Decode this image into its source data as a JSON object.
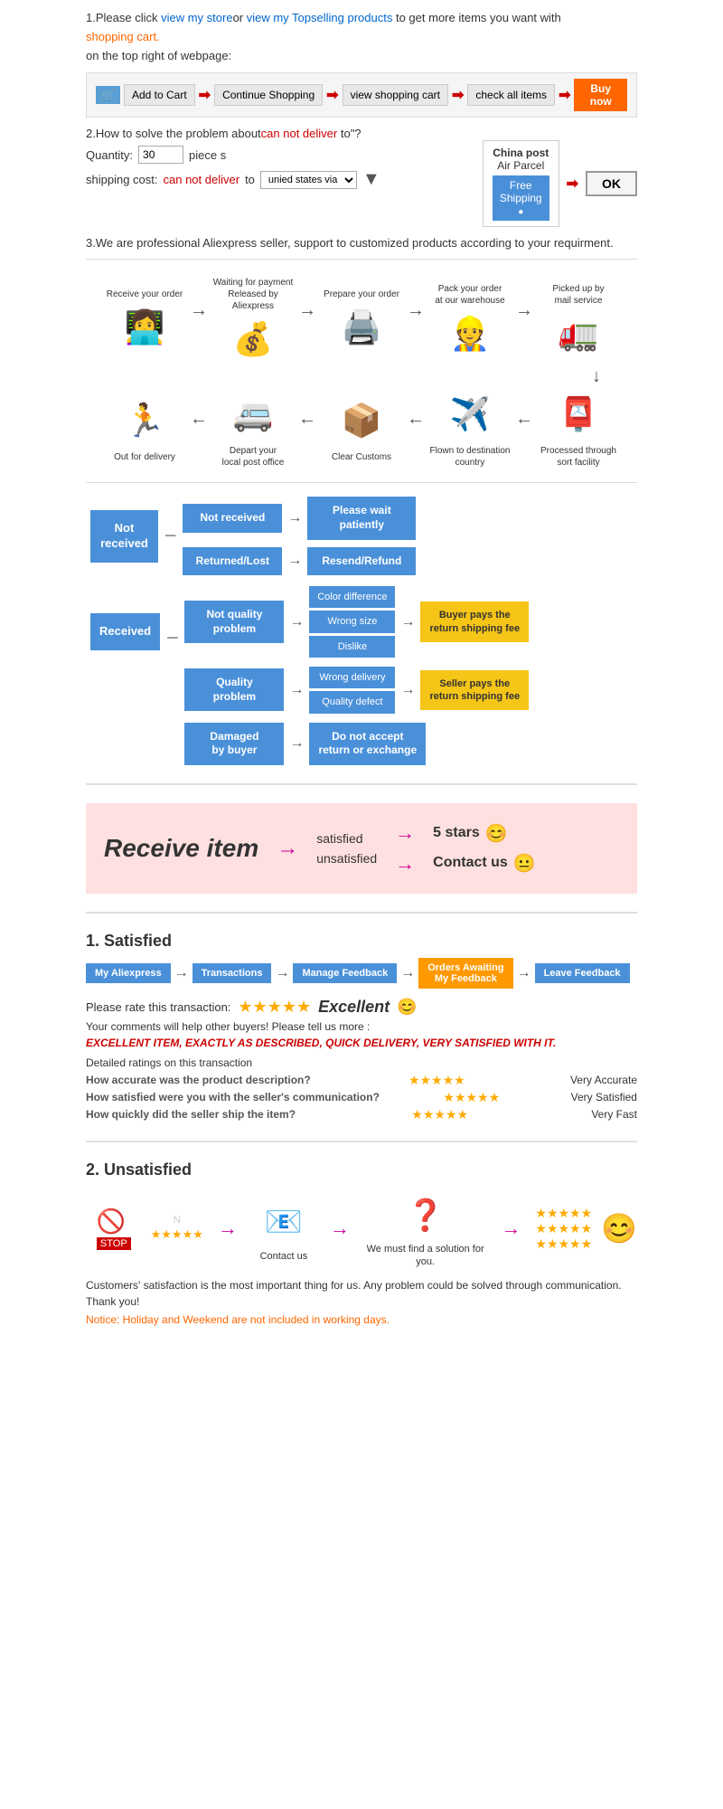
{
  "section1": {
    "text1": "1.Please click ",
    "link1": "view my store",
    "text2": "or ",
    "link2": "view my Topselling products",
    "text3": " to get more items you want with",
    "text4": "shopping cart.",
    "text5": "on the top right of webpage:",
    "cart_icon": "🛒",
    "steps": [
      "Add to Cart",
      "Continue Shopping",
      "view shopping cart",
      "check all items",
      "Buy now"
    ]
  },
  "section2": {
    "title": "2.How to solve the problem about",
    "problem": "can not deliver",
    "title2": " to\"?",
    "qty_label": "Quantity:",
    "qty_value": "30",
    "qty_suffix": "piece s",
    "shipping_label": "shipping cost:",
    "shipping_problem": "can not deliver",
    "shipping_to": " to ",
    "shipping_via": "unied states via",
    "china_post_title": "China post",
    "china_post_sub": "Air Parcel",
    "free_shipping": "Free\nShipping",
    "ok_label": "OK"
  },
  "section3": {
    "text": "3.We are professional Aliexpress seller, support to customized products according to your requirment."
  },
  "process": {
    "row1": [
      {
        "icon": "👩‍💻",
        "label": "Receive your order"
      },
      {
        "icon": "💰",
        "label": "Waiting for payment\nReleased by Aliexpress"
      },
      {
        "icon": "🖨️",
        "label": "Prepare your order"
      },
      {
        "icon": "👷",
        "label": "Pack your order\nat our warehouse"
      },
      {
        "icon": "🚛",
        "label": "Picked up by\nmail service"
      }
    ],
    "row2": [
      {
        "icon": "🏃",
        "label": "Out for delivery"
      },
      {
        "icon": "🚐",
        "label": "Depart your\nlocal post office"
      },
      {
        "icon": "📦",
        "label": "Clear Customs"
      },
      {
        "icon": "✈️",
        "label": "Flown to destination\ncountry"
      },
      {
        "icon": "📮",
        "label": "Processed through\nsort facility"
      }
    ]
  },
  "flowchart": {
    "not_received": "Not received",
    "nr_sub1": "Not received",
    "nr_outcome1": "Please wait\npatiently",
    "nr_sub2": "Returned/Lost",
    "nr_outcome2": "Resend/Refund",
    "received": "Received",
    "rec_sub1": "Not quality\nproblem",
    "rec_sub1_small": [
      "Color difference",
      "Wrong size",
      "Dislike"
    ],
    "rec_sub1_outcome": "Buyer pays the\nreturn shipping fee",
    "rec_sub2": "Quality\nproblem",
    "rec_sub2_small": [
      "Wrong delivery",
      "Quality defect"
    ],
    "rec_sub2_outcome": "Seller pays the\nreturn shipping fee",
    "rec_sub3": "Damaged\nby buyer",
    "rec_sub3_outcome": "Do not accept\nreturn or exchange"
  },
  "receive_item": {
    "title": "Receive item",
    "satisfied": "satisfied",
    "unsatisfied": "unsatisfied",
    "satisfied_result": "5 stars",
    "unsatisfied_result": "Contact us",
    "satisfied_emoji": "😊",
    "unsatisfied_emoji": "😐"
  },
  "satisfied": {
    "title": "1. Satisfied",
    "nav": [
      "My Aliexpress",
      "Transactions",
      "Manage Feedback",
      "Orders Awaiting\nMy Feedback",
      "Leave Feedback"
    ],
    "rate_label": "Please rate this transaction:",
    "excellent": "Excellent",
    "excellent_emoji": "😊",
    "comments_label": "Your comments will help other buyers! Please tell us more :",
    "excellent_text": "EXCELLENT ITEM, EXACTLY AS DESCRIBED, QUICK DELIVERY, VERY SATISFIED WITH IT.",
    "detailed_label": "Detailed ratings on this transaction",
    "ratings": [
      {
        "q": "How accurate was the product description?",
        "stars": "★★★★★",
        "label": "Very Accurate"
      },
      {
        "q": "How satisfied were you with the seller's communication?",
        "stars": "★★★★★",
        "label": "Very Satisfied"
      },
      {
        "q": "How quickly did the seller ship the item?",
        "stars": "★★★★★",
        "label": "Very Fast"
      }
    ]
  },
  "unsatisfied": {
    "title": "2. Unsatisfied",
    "contact_label": "Contact us",
    "find_label": "We must find\na solution for\nyou.",
    "notice": "Customers' satisfaction is the most important thing for us. Any problem could be solved through communication. Thank you!",
    "notice2": "Notice: Holiday and Weekend are not included in working days."
  }
}
